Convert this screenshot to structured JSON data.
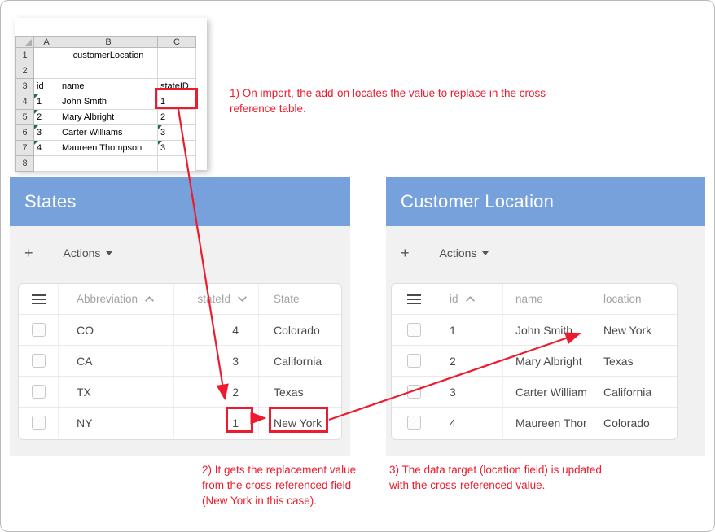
{
  "colors": {
    "panel_header_blue": "#76a1db",
    "annotation_red": "#ee1b2e",
    "toolbar_gray": "#f1f1f1",
    "excel_flag_green": "#1e7145"
  },
  "icons": {
    "menu": "hamburger-icon",
    "sort_up": "chevron-up-icon",
    "sort_down": "chevron-down-icon",
    "actions_dropdown": "caret-down-icon",
    "select_all_corner": "corner-triangle-icon"
  },
  "spreadsheet": {
    "col_headers": [
      "A",
      "B",
      "C"
    ],
    "row_numbers": [
      "1",
      "2",
      "3",
      "4",
      "5",
      "6",
      "7",
      "8"
    ],
    "title": "customerLocation",
    "field_headers": {
      "id": "id",
      "name": "name",
      "stateID": "stateID"
    },
    "records": [
      {
        "id": "1",
        "name": "John Smith",
        "stateID": "1"
      },
      {
        "id": "2",
        "name": "Mary Albright",
        "stateID": "2"
      },
      {
        "id": "3",
        "name": "Carter Williams",
        "stateID": "3"
      },
      {
        "id": "4",
        "name": "Maureen Thompson",
        "stateID": "3"
      }
    ]
  },
  "annotations": {
    "note1": "1) On import, the add-on locates the value to replace in the cross-reference table.",
    "note2": "2) It gets the replacement value from the cross-referenced field (New York in this case).",
    "note3": "3) The data target (location field) is updated with the cross-referenced value."
  },
  "states_panel": {
    "title": "States",
    "toolbar": {
      "add_label": "+",
      "actions_label": "Actions"
    },
    "columns": {
      "abbreviation": "Abbreviation",
      "stateId": "stateId",
      "state": "State"
    },
    "rows": [
      {
        "abbreviation": "CO",
        "stateId": "4",
        "state": "Colorado"
      },
      {
        "abbreviation": "CA",
        "stateId": "3",
        "state": "California"
      },
      {
        "abbreviation": "TX",
        "stateId": "2",
        "state": "Texas"
      },
      {
        "abbreviation": "NY",
        "stateId": "1",
        "state": "New York"
      }
    ]
  },
  "customer_panel": {
    "title": "Customer Location",
    "toolbar": {
      "add_label": "+",
      "actions_label": "Actions"
    },
    "columns": {
      "id": "id",
      "name": "name",
      "location": "location"
    },
    "rows": [
      {
        "id": "1",
        "name": "John Smith",
        "location": "New York"
      },
      {
        "id": "2",
        "name": "Mary Albright",
        "location": "Texas"
      },
      {
        "id": "3",
        "name": "Carter Williams",
        "location": "California"
      },
      {
        "id": "4",
        "name": "Maureen Thompson",
        "location": "Colorado"
      }
    ]
  }
}
